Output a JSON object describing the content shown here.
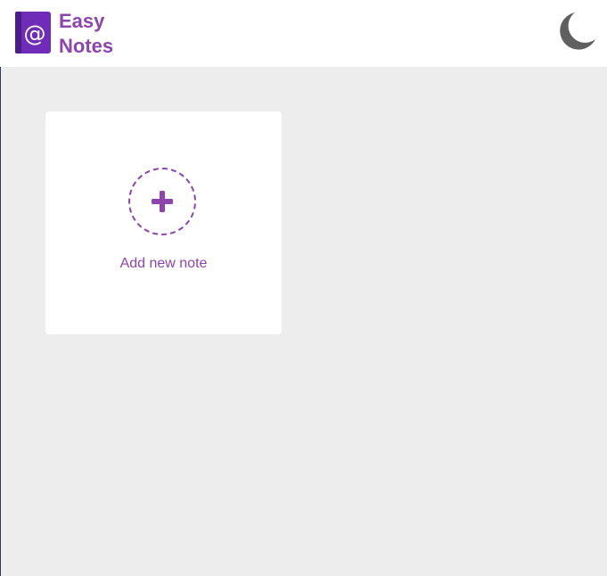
{
  "header": {
    "brand_line1": "Easy",
    "brand_line2": "Notes",
    "logo_icon": "address-book-icon",
    "theme_toggle_icon": "moon-icon"
  },
  "main": {
    "add_note_label": "Add new note",
    "add_note_icon": "plus-icon"
  },
  "colors": {
    "accent": "#8e44ad",
    "logo_purple": "#6f2db7",
    "background": "#ededed",
    "header_background": "#ffffff",
    "moon": "#606060"
  }
}
